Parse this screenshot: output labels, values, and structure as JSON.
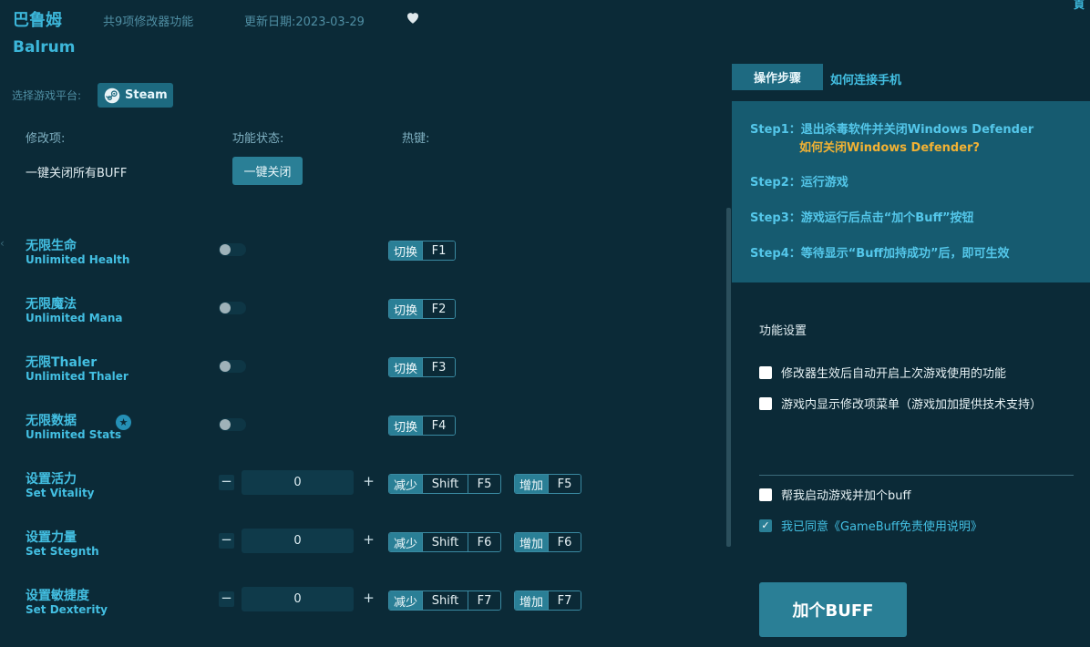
{
  "header": {
    "title_cn": "巴鲁姆",
    "feature_count": "共9项修改器功能",
    "updated": "更新日期:2023-03-29",
    "corner_mark": "頁",
    "title_en": "Balrum"
  },
  "platform": {
    "label": "选择游戏平台:",
    "steam_label": "Steam"
  },
  "columns": {
    "mod": "修改项:",
    "status": "功能状态:",
    "hotkey": "热键:"
  },
  "all_buff": {
    "label": "一键关闭所有BUFF",
    "button": "一键关闭"
  },
  "left_edge_mark": "‹",
  "toggles": [
    {
      "cn": "无限生命",
      "en": "Unlimited Health",
      "tag": "切换",
      "key": "F1"
    },
    {
      "cn": "无限魔法",
      "en": "Unlimited Mana",
      "tag": "切换",
      "key": "F2"
    },
    {
      "cn": "无限Thaler",
      "en": "Unlimited Thaler",
      "tag": "切换",
      "key": "F3"
    },
    {
      "cn": "无限数据",
      "en": "Unlimited Stats",
      "tag": "切换",
      "key": "F4",
      "star": "★"
    }
  ],
  "steppers": [
    {
      "cn": "设置活力",
      "en": "Set Vitality",
      "value": "0",
      "minus": "−",
      "plus": "+",
      "dec_tag": "减少",
      "dec_mod": "Shift",
      "dec_key": "F5",
      "inc_tag": "增加",
      "inc_key": "F5"
    },
    {
      "cn": "设置力量",
      "en": "Set Stegnth",
      "value": "0",
      "minus": "−",
      "plus": "+",
      "dec_tag": "减少",
      "dec_mod": "Shift",
      "dec_key": "F6",
      "inc_tag": "增加",
      "inc_key": "F6"
    },
    {
      "cn": "设置敏捷度",
      "en": "Set Dexterity",
      "value": "0",
      "minus": "−",
      "plus": "+",
      "dec_tag": "减少",
      "dec_mod": "Shift",
      "dec_key": "F7",
      "inc_tag": "增加",
      "inc_key": "F7"
    }
  ],
  "tabs": {
    "active": "操作步骤",
    "inactive": "如何连接手机"
  },
  "steps": {
    "s1": "Step1：退出杀毒软件并关闭Windows Defender",
    "s1_link": "如何关闭Windows Defender?",
    "s2": "Step2：运行游戏",
    "s3": "Step3：游戏运行后点击“加个Buff”按钮",
    "s4": "Step4：等待显示“Buff加持成功”后，即可生效"
  },
  "settings": {
    "title": "功能设置",
    "opt1": "修改器生效后自动开启上次游戏使用的功能",
    "opt2": "游戏内显示修改项菜单（游戏加加提供技术支持）",
    "opt3": "帮我启动游戏并加个buff",
    "agree": "我已同意《GameBuff免责使用说明》",
    "check_mark": "✓"
  },
  "buff_button": "加个BUFF",
  "colors": {
    "background": "#0b2a37",
    "accent": "#43bfe2",
    "button": "#2a7f96",
    "link_orange": "#f2b233"
  }
}
